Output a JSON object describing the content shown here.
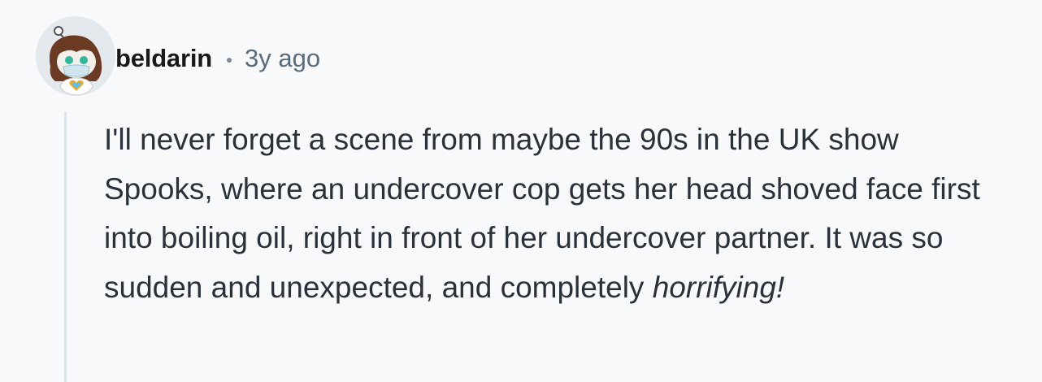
{
  "comment": {
    "username": "beldarin",
    "separator": "•",
    "timestamp": "3y ago",
    "avatar_icon": "user-avatar-snoo-icon",
    "body_text": "I'll never forget a scene from maybe the 90s in the UK show Spooks, where an undercover cop gets her head shoved face first into boiling oil, right in front of her undercover partner. It was so sudden and unexpected, and completely ",
    "body_emphasis": "horrifying!"
  },
  "colors": {
    "background": "#f7f9fb",
    "username": "#1a1a1b",
    "timestamp": "#5a6b7c",
    "body": "#2a3138",
    "thread_line": "#dbe3ec"
  }
}
